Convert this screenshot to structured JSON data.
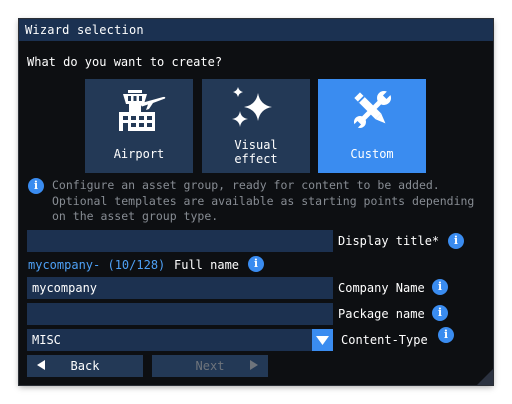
{
  "window": {
    "title": "Wizard selection"
  },
  "prompt": "What do you want to create?",
  "tiles": [
    {
      "label": "Airport",
      "icon": "airport-tower-icon"
    },
    {
      "label": "Visual\neffect",
      "icon": "sparkles-icon"
    },
    {
      "label": "Custom",
      "icon": "tools-icon",
      "selected": true
    }
  ],
  "description": "Configure an asset group, ready for content to be added. Optional templates are available as starting points depending on the asset group type.",
  "form": {
    "display_title": {
      "label": "Display title*",
      "value": ""
    },
    "full_name": {
      "label": "Full name",
      "prefix": "mycompany- (10/128)"
    },
    "company_name": {
      "label": "Company Name",
      "value": "mycompany"
    },
    "package_name": {
      "label": "Package name",
      "value": ""
    },
    "content_type": {
      "label": "Content-Type",
      "value": "MISC"
    }
  },
  "buttons": {
    "back": "Back",
    "next": "Next"
  },
  "colors": {
    "accent": "#3a8cf0",
    "tile": "#233956",
    "titlebar": "#1b3151",
    "background": "#0d0f12"
  }
}
